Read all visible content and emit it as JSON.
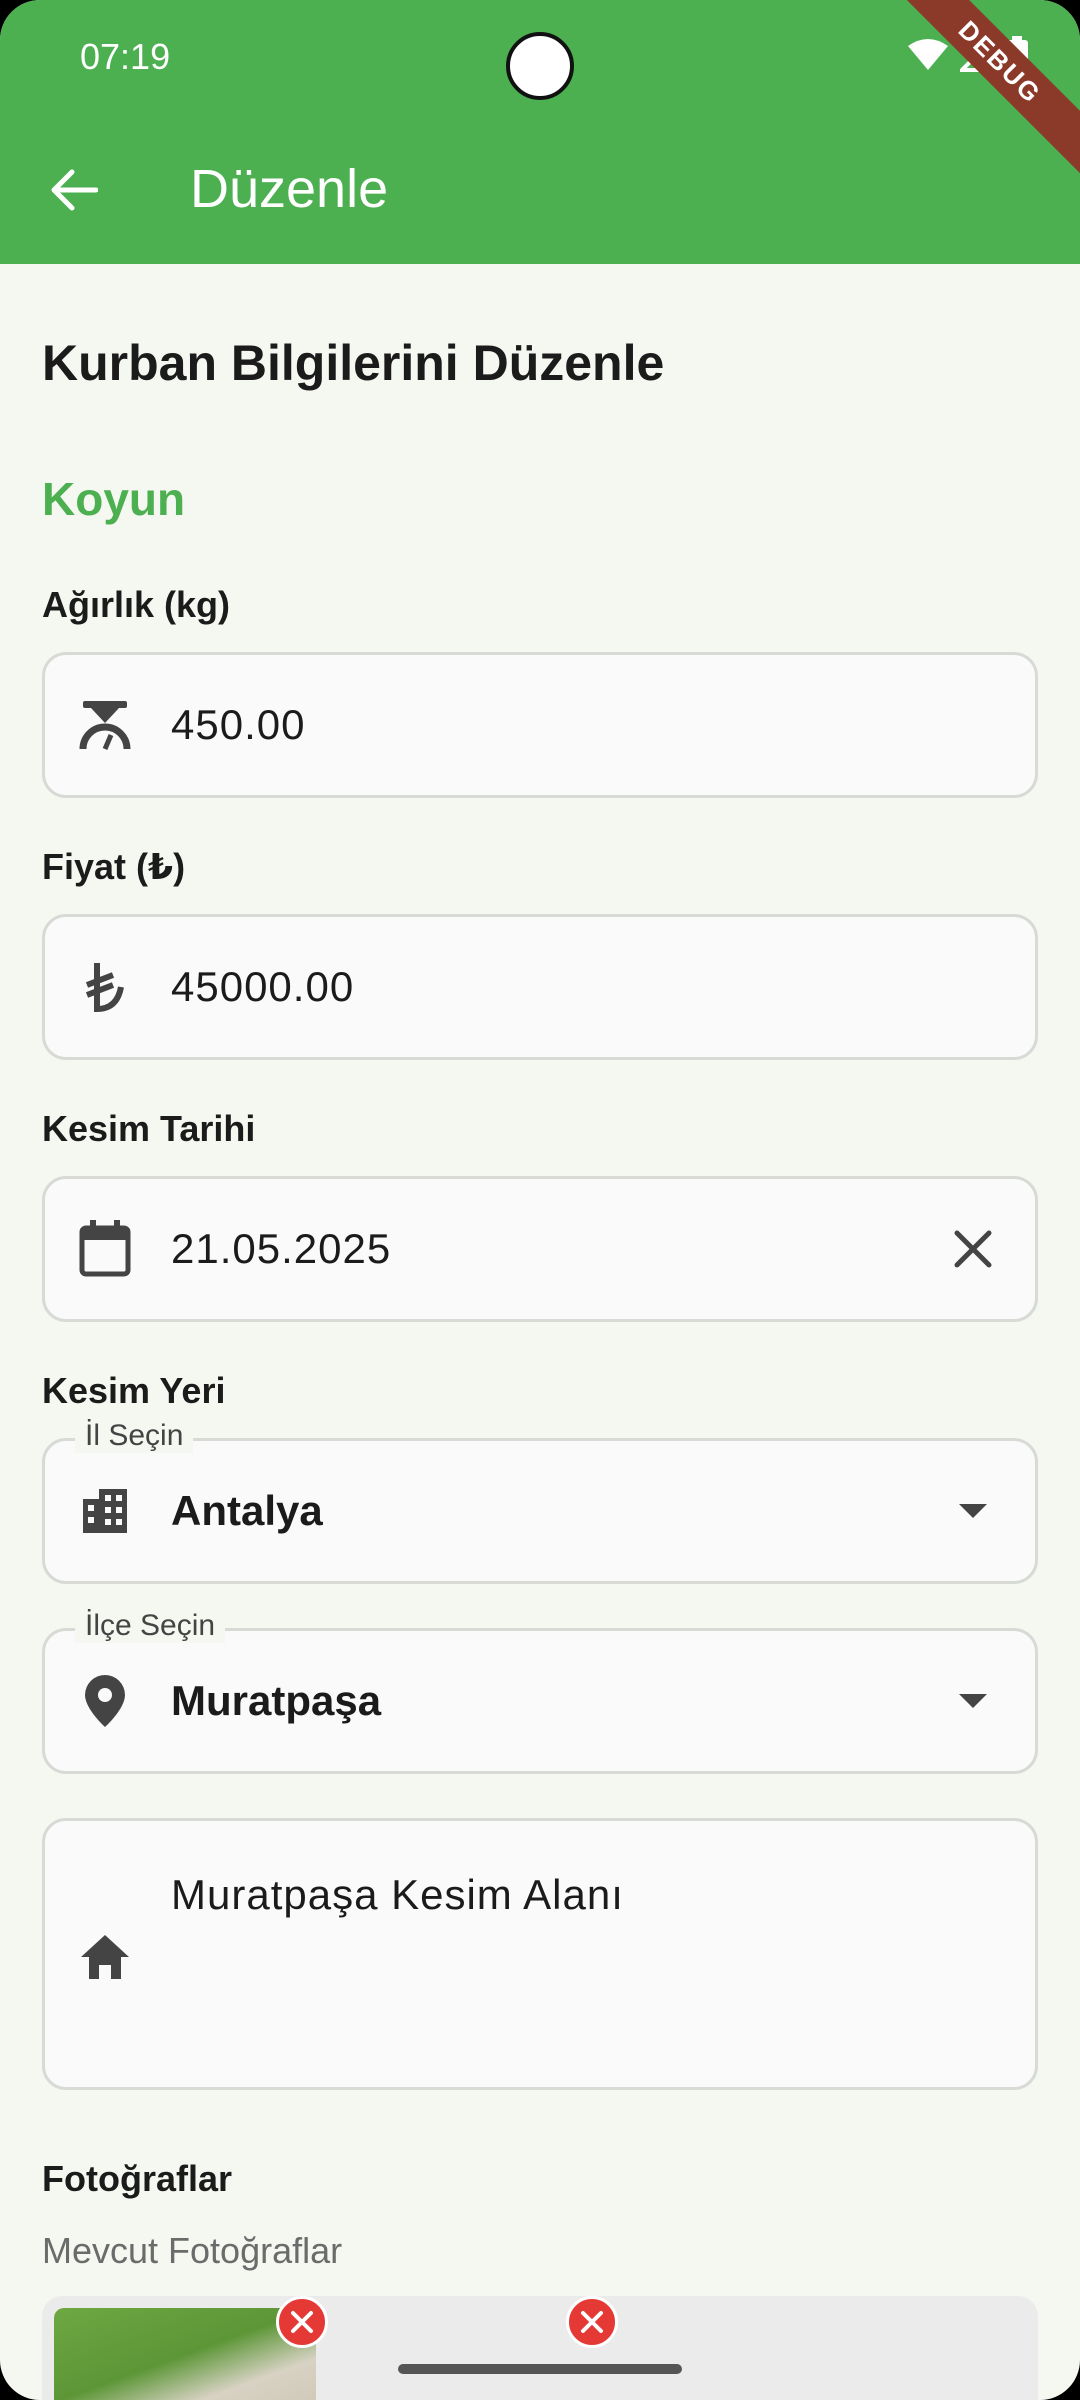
{
  "status_bar": {
    "time": "07:19"
  },
  "debug_banner": "DEBUG",
  "app_bar": {
    "title": "Düzenle"
  },
  "form": {
    "page_title": "Kurban Bilgilerini Düzenle",
    "animal_type": "Koyun",
    "weight": {
      "label": "Ağırlık (kg)",
      "value": "450.00",
      "icon": "scale-icon"
    },
    "price": {
      "label": "Fiyat (₺)",
      "value": "45000.00",
      "icon": "lira-icon"
    },
    "slaughter_date": {
      "label": "Kesim Tarihi",
      "value": "21.05.2025",
      "icon": "calendar-icon"
    },
    "slaughter_place": {
      "label": "Kesim Yeri",
      "province": {
        "floating_label": "İl Seçin",
        "value": "Antalya",
        "icon": "city-icon"
      },
      "district": {
        "floating_label": "İlçe Seçin",
        "value": "Muratpaşa",
        "icon": "location-pin-icon"
      },
      "address": {
        "value": "Muratpaşa Kesim Alanı",
        "icon": "home-icon"
      }
    },
    "photos": {
      "label": "Fotoğraflar",
      "existing_label": "Mevcut Fotoğraflar"
    }
  },
  "colors": {
    "primary": "#4caf50",
    "background": "#f5f8f0",
    "remove": "#e53935"
  }
}
